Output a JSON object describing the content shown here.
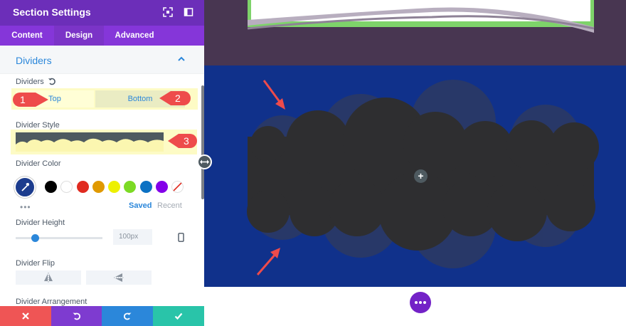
{
  "panel": {
    "title": "Section Settings",
    "tabs": [
      {
        "label": "Content",
        "active": false
      },
      {
        "label": "Design",
        "active": true
      },
      {
        "label": "Advanced",
        "active": false
      }
    ],
    "section_title": "Dividers",
    "dividers_label": "Dividers",
    "segment": {
      "top": "Top",
      "bottom": "Bottom"
    },
    "divider_style_label": "Divider Style",
    "divider_color_label": "Divider Color",
    "swatches": [
      "#000000",
      "#ffffff",
      "#e02b20",
      "#e09900",
      "#edf000",
      "#7cda24",
      "#0c71c3",
      "#8300e9"
    ],
    "swatch_tabs": {
      "saved": "Saved",
      "recent": "Recent"
    },
    "more_dots": "•••",
    "divider_height_label": "Divider Height",
    "divider_height_value": "100px",
    "divider_height_fraction": 0.22,
    "divider_flip_label": "Divider Flip",
    "divider_arrangement_label": "Divider Arrangement",
    "callouts": [
      "1",
      "2",
      "3"
    ]
  },
  "canvas": {
    "add_symbol": "+"
  },
  "colors": {
    "header": "#6c2eb9",
    "tabs": "#8536d9",
    "accent": "#2b87da",
    "footer_cancel": "#ef5555",
    "footer_undo": "#7e3bd0",
    "footer_redo": "#2b87da",
    "footer_save": "#29c4a9",
    "section_blue": "#10318b",
    "section_top": "#483651",
    "divider": "#2e2e30"
  },
  "icons": [
    "fullscreen-icon",
    "sidebar-icon",
    "chevron-up-icon",
    "reset-icon",
    "eyedropper-icon",
    "phone-icon",
    "flip-horizontal-icon",
    "flip-vertical-icon",
    "close-icon",
    "undo-icon",
    "redo-icon",
    "check-icon",
    "resize-arrows-icon",
    "plus-icon",
    "more-icon"
  ]
}
